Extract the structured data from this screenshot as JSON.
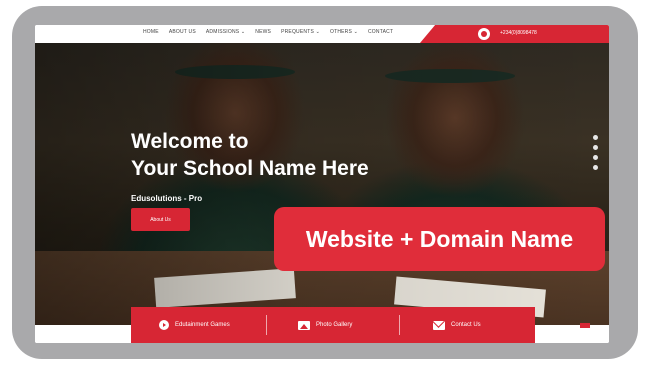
{
  "nav": {
    "items": [
      "HOME",
      "ABOUT US",
      "ADMISSIONS ⌄",
      "NEWS",
      "PREQUENTS ⌄",
      "OTHERS ⌄",
      "CONTACT"
    ],
    "phone": "+234(0)8098478"
  },
  "hero": {
    "title_line1": "Welcome to",
    "title_line2": "Your School Name Here",
    "subtitle": "Edusolutions - Pro",
    "cta": "About Us"
  },
  "bottom_bar": {
    "items": [
      {
        "label": "Edutainment Games",
        "icon": "play-icon"
      },
      {
        "label": "Photo Gallery",
        "icon": "photo-icon"
      },
      {
        "label": "Contact Us",
        "icon": "mail-icon"
      }
    ]
  },
  "badge": {
    "text": "Website + Domain Name"
  },
  "colors": {
    "accent": "#d72634",
    "frame": "#a9a9ab"
  }
}
